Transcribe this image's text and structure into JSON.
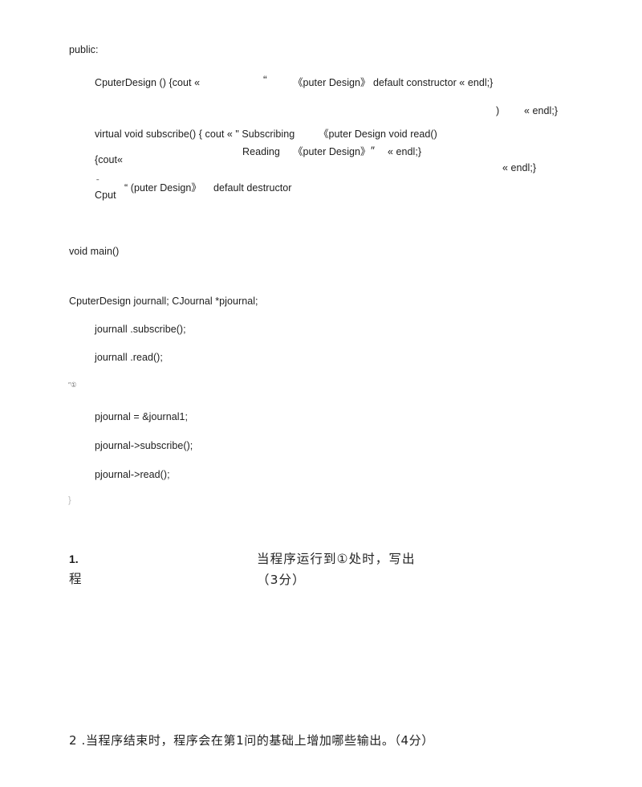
{
  "document": {
    "type": "scanned-exam-page",
    "page_background": "#ffffff",
    "text_color": "#1d1d1d"
  },
  "code_block": {
    "access_specifier": "public:",
    "constructor_line": "CputerDesign () {cout «",
    "constructor_quote": "“",
    "constructor_title": "《puter Design》",
    "constructor_tail": "default constructor « endl;}",
    "stray_paren": ")",
    "stray_endl_1": "« endl;}",
    "subscribe_line": "virtual void subscribe() { cout « \" Subscribing",
    "subscribe_title_fragment": "《puter Design void read()",
    "reading_word": "Reading",
    "reading_title": "《puter Design》",
    "reading_close_quote": "″",
    "reading_endl": "« endl;}",
    "cout_fragment": "{cout«",
    "stray_endl_2": "« endl;}",
    "destructor_tilde": "ˉ",
    "destructor_name": "Cput",
    "destructor_quote": "“ (puter Design》",
    "destructor_tail": "default destructor"
  },
  "main_block": {
    "main_signature": "void main()",
    "declarations": "CputerDesign journall; CJournal *pjournal;",
    "statements": [
      "journall .subscribe();",
      "journall .read();"
    ],
    "marker_fragment": "″①",
    "pointer_statements": [
      "pjournal = &journal1;",
      "pjournal->subscribe();",
      "pjournal->read();"
    ],
    "closing_brace": "}"
  },
  "questions": [
    {
      "number": "1.",
      "continuation": "程",
      "text": "当程序运行到①处时，写出",
      "points": "（3分）"
    },
    {
      "number": "2 .",
      "text": "当程序结束时，程序会在第1问的基础上增加哪些输出。",
      "points": "（4分）"
    }
  ]
}
